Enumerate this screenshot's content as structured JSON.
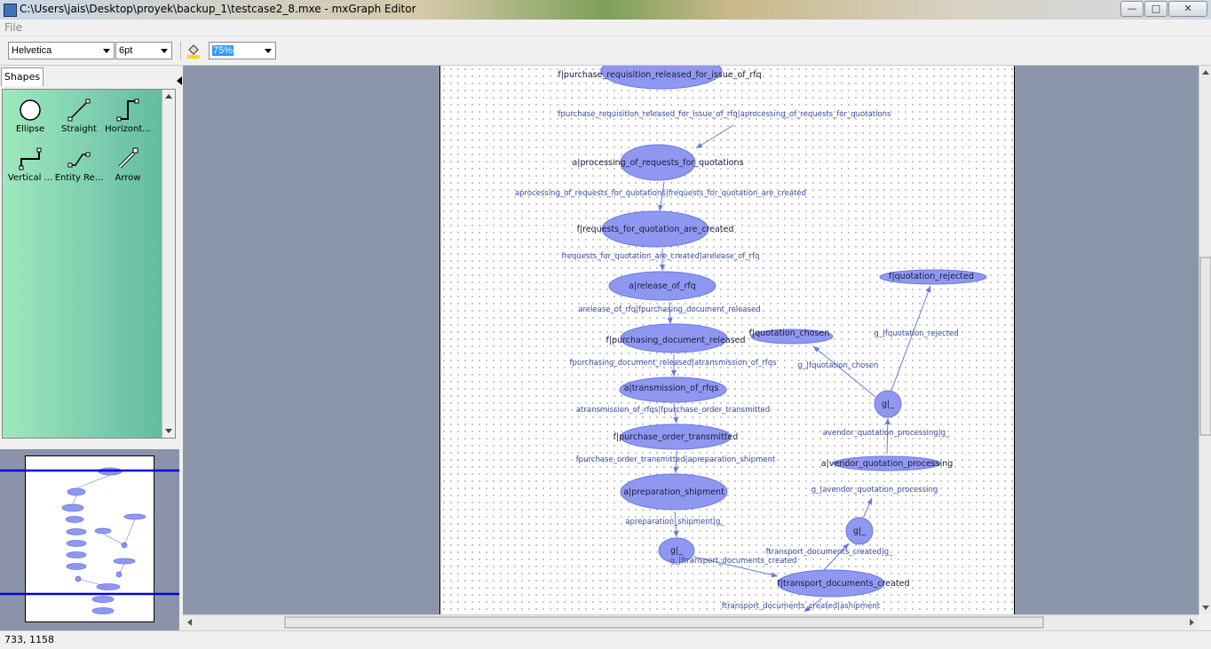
{
  "window": {
    "title": "C:\\Users\\jais\\Desktop\\proyek\\backup_1\\testcase2_8.mxe - mxGraph Editor"
  },
  "window_controls": {
    "minimize": "—",
    "maximize": "□",
    "close": "✕"
  },
  "menu": {
    "file": "File"
  },
  "toolbar": {
    "font": "Helvetica",
    "size": "6pt",
    "zoom": "75%"
  },
  "sidebar": {
    "tab": "Shapes",
    "shapes": [
      {
        "label": "Ellipse",
        "icon": "ellipse-icon"
      },
      {
        "label": "Straight",
        "icon": "straight-connector-icon"
      },
      {
        "label": "Horizont...",
        "icon": "horizontal-connector-icon"
      },
      {
        "label": "Vertical ...",
        "icon": "vertical-connector-icon"
      },
      {
        "label": "Entity Re...",
        "icon": "entity-relation-icon"
      },
      {
        "label": "Arrow",
        "icon": "arrow-icon"
      }
    ]
  },
  "graph": {
    "nodes": [
      {
        "id": "n1",
        "label": "f|purchase_requisition_released_for_issue_of_rfq"
      },
      {
        "id": "n2",
        "label": "a|processing_of_requests_for_quotations"
      },
      {
        "id": "n3",
        "label": "f|requests_for_quotation_are_created"
      },
      {
        "id": "n4",
        "label": "a|release_of_rfq"
      },
      {
        "id": "n5",
        "label": "f|purchasing_document_released"
      },
      {
        "id": "n6",
        "label": "a|transmission_of_rfqs"
      },
      {
        "id": "n7",
        "label": "f|purchase_order_transmitted"
      },
      {
        "id": "n8",
        "label": "a|preparation_shipment"
      },
      {
        "id": "n9",
        "label": "g|_"
      },
      {
        "id": "n10",
        "label": "f|transport_documents_created"
      },
      {
        "id": "n11",
        "label": "g|_"
      },
      {
        "id": "n12",
        "label": "a|vendor_quotation_processing"
      },
      {
        "id": "n13",
        "label": "g|_"
      },
      {
        "id": "n14",
        "label": "f|quotation_chosen"
      },
      {
        "id": "n15",
        "label": "f|quotation_rejected"
      }
    ],
    "edges": [
      {
        "from": "n1",
        "to": "n2",
        "label": "fpurchase_requisition_released_for_issue_of_rfq|aprocessing_of_requests_for_quotations"
      },
      {
        "from": "n2",
        "to": "n3",
        "label": "aprocessing_of_requests_for_quotations|frequests_for_quotation_are_created"
      },
      {
        "from": "n3",
        "to": "n4",
        "label": "frequests_for_quotation_are_created|arelease_of_rfq"
      },
      {
        "from": "n4",
        "to": "n5",
        "label": "arelease_of_rfq|fpurchasing_document_released"
      },
      {
        "from": "n5",
        "to": "n6",
        "label": "fpurchasing_document_released|atransmission_of_rfqs"
      },
      {
        "from": "n6",
        "to": "n7",
        "label": "atransmission_of_rfqs|fpurchase_order_transmitted"
      },
      {
        "from": "n7",
        "to": "n8",
        "label": "fpurchase_order_transmitted|apreparation_shipment"
      },
      {
        "from": "n8",
        "to": "n9",
        "label": "apreparation_shipment|g_"
      },
      {
        "from": "n9",
        "to": "n10",
        "label": "g_|ftransport_documents_created"
      },
      {
        "from": "n10",
        "to": "n11",
        "label": "ftransport_documents_created|g_"
      },
      {
        "from": "n11",
        "to": "n12",
        "label": "g_|avendor_quotation_processing"
      },
      {
        "from": "n12",
        "to": "n13",
        "label": "avendor_quotation_processing|g_"
      },
      {
        "from": "n13",
        "to": "n14",
        "label": "g_|fquotation_chosen"
      },
      {
        "from": "n13",
        "to": "n15",
        "label": "g_|fquotation_rejected"
      },
      {
        "from": "n10",
        "to": "out",
        "label": "ftransport_documents_created|ashipment"
      }
    ]
  },
  "status": {
    "coords": "733, 1158"
  },
  "colors": {
    "node_fill": "#8f98f0",
    "node_stroke": "#6b78e0",
    "edge": "#6b78e0",
    "edge_label": "#3a4aa0"
  }
}
